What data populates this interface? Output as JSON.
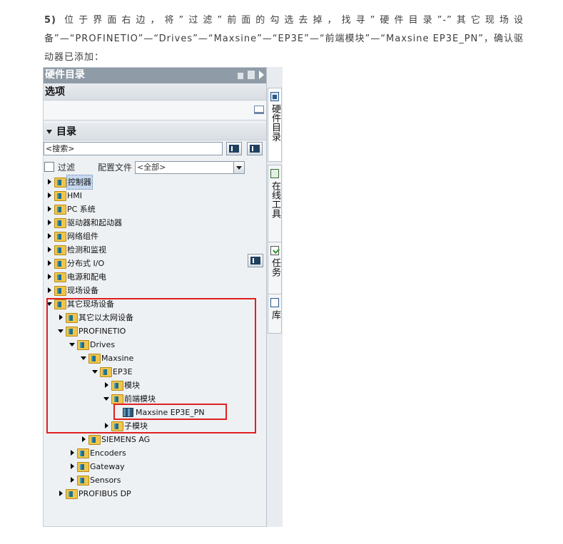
{
  "instruction": {
    "step": "5)",
    "text": " 位于界面右边，将”过滤”前面的勾选去掉，找寻”硬件目录”-”其它现场设备”—“PROFINETIO”—“Drives”—“Maxsine”—“EP3E”—“前端模块”—“Maxsine EP3E_PN”，确认驱动器已添加："
  },
  "panel": {
    "title": "硬件目录",
    "options_header": "选项",
    "catalog_header": "目录",
    "search_placeholder": "<搜索>",
    "filter_label": "过滤",
    "filter_checked": false,
    "profile_label": "配置文件",
    "profile_value": "<全部>"
  },
  "tree": [
    {
      "label": "控制器",
      "level": 0,
      "state": "collapsed",
      "icon": "folder-icon",
      "highlight": true
    },
    {
      "label": "HMI",
      "level": 0,
      "state": "collapsed",
      "icon": "folder-icon"
    },
    {
      "label": "PC 系统",
      "level": 0,
      "state": "collapsed",
      "icon": "folder-icon"
    },
    {
      "label": "驱动器和起动器",
      "level": 0,
      "state": "collapsed",
      "icon": "folder-icon"
    },
    {
      "label": "网络组件",
      "level": 0,
      "state": "collapsed",
      "icon": "folder-icon"
    },
    {
      "label": "检测和监视",
      "level": 0,
      "state": "collapsed",
      "icon": "folder-icon"
    },
    {
      "label": "分布式 I/O",
      "level": 0,
      "state": "collapsed",
      "icon": "folder-icon"
    },
    {
      "label": "电源和配电",
      "level": 0,
      "state": "collapsed",
      "icon": "folder-icon"
    },
    {
      "label": "现场设备",
      "level": 0,
      "state": "collapsed",
      "icon": "folder-icon"
    },
    {
      "label": "其它现场设备",
      "level": 0,
      "state": "expanded",
      "icon": "folder-icon"
    },
    {
      "label": "其它以太网设备",
      "level": 1,
      "state": "collapsed",
      "icon": "folder-icon"
    },
    {
      "label": "PROFINETIO",
      "level": 1,
      "state": "expanded",
      "icon": "folder-icon"
    },
    {
      "label": "Drives",
      "level": 2,
      "state": "expanded",
      "icon": "folder-icon"
    },
    {
      "label": "Maxsine",
      "level": 3,
      "state": "expanded",
      "icon": "folder-icon"
    },
    {
      "label": "EP3E",
      "level": 4,
      "state": "expanded",
      "icon": "folder-icon"
    },
    {
      "label": "模块",
      "level": 5,
      "state": "collapsed",
      "icon": "folder-icon"
    },
    {
      "label": "前端模块",
      "level": 5,
      "state": "expanded",
      "icon": "folder-icon"
    },
    {
      "label": "Maxsine EP3E_PN",
      "level": 6,
      "state": "leaf",
      "icon": "device-icon"
    },
    {
      "label": "子模块",
      "level": 5,
      "state": "collapsed",
      "icon": "folder-icon"
    },
    {
      "label": "SIEMENS AG",
      "level": 3,
      "state": "collapsed",
      "icon": "folder-icon"
    },
    {
      "label": "Encoders",
      "level": 2,
      "state": "collapsed",
      "icon": "folder-icon"
    },
    {
      "label": "Gateway",
      "level": 2,
      "state": "collapsed",
      "icon": "folder-icon"
    },
    {
      "label": "Sensors",
      "level": 2,
      "state": "collapsed",
      "icon": "folder-icon"
    },
    {
      "label": "PROFIBUS DP",
      "level": 1,
      "state": "collapsed",
      "icon": "folder-icon"
    }
  ],
  "side_tabs": [
    {
      "label": "硬件目录",
      "icon": "catalog-icon",
      "active": true
    },
    {
      "label": "在线工具",
      "icon": "online-tools-icon",
      "active": false
    },
    {
      "label": "任务",
      "icon": "tasks-icon",
      "active": false
    },
    {
      "label": "库",
      "icon": "library-icon",
      "active": false
    }
  ],
  "annotation_color": "#e02020"
}
